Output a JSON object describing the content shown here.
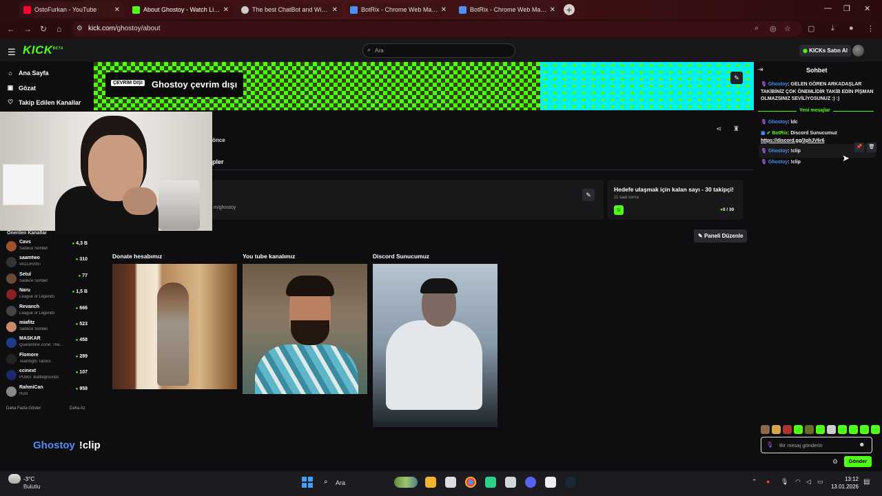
{
  "browser": {
    "tabs": [
      {
        "title": "OstoFurkan - YouTube",
        "favicon_color": "#ff0033"
      },
      {
        "title": "About Ghostoy - Watch Live on Kick",
        "favicon_color": "#53fc18"
      },
      {
        "title": "The best ChatBot and Widgets",
        "favicon_color": "#cccccc"
      },
      {
        "title": "BotRix - Chrome Web Mağazası",
        "favicon_color": "#4e8ef7"
      },
      {
        "title": "BotRix - Chrome Web Mağazası",
        "favicon_color": "#4e8ef7"
      }
    ],
    "url_host": "kick.com",
    "url_path": "/ghostoy/about"
  },
  "topnav": {
    "logo": "KICK",
    "logo_sup": "BETA",
    "search_placeholder": "Ara",
    "buy_kicks": "KICKs Satın Al"
  },
  "sidebar": {
    "nav": [
      {
        "label": "Ana Sayfa",
        "icon": "home-icon"
      },
      {
        "label": "Gözat",
        "icon": "browse-icon"
      },
      {
        "label": "Takip Edilen Kanallar",
        "icon": "heart-icon"
      }
    ],
    "suggested_title": "Önerilen Kanallar",
    "channels": [
      {
        "name": "Cavs",
        "category": "Sadece Sohbet",
        "viewers": "4,3 B",
        "color": "#a0522d"
      },
      {
        "name": "saamtwo",
        "category": "VALORANT",
        "viewers": "310",
        "color": "#333333"
      },
      {
        "name": "Setul",
        "category": "Sadece Sohbet",
        "viewers": "77",
        "color": "#6b4a33"
      },
      {
        "name": "Naru",
        "category": "League of Legends",
        "viewers": "1,5 B",
        "color": "#8a2020"
      },
      {
        "name": "Revanch",
        "category": "League of Legends",
        "viewers": "666",
        "color": "#444444"
      },
      {
        "name": "miafitz",
        "category": "Sadece Sohbet",
        "viewers": "523",
        "color": "#c88a6a"
      },
      {
        "name": "MASKAR",
        "category": "Quarantine Zone: The...",
        "viewers": "458",
        "color": "#1f3b8a"
      },
      {
        "name": "Flomore",
        "category": "Teamfight Tactics",
        "viewers": "289",
        "color": "#222222"
      },
      {
        "name": "ccinext",
        "category": "PUBG: Battlegrounds",
        "viewers": "107",
        "color": "#1b2a6b"
      },
      {
        "name": "RahmiCan",
        "category": "Rust",
        "viewers": "958",
        "color": "#888888"
      }
    ],
    "show_more": "Daha Fazla Göster",
    "show_less": "Daha Az"
  },
  "banner": {
    "offline_badge": "ÇEVRİM DIŞI",
    "offline_text": "Ghostoy çevrim dışı"
  },
  "channel": {
    "tab_partial_1": "önce",
    "tab_partial_2": "pler",
    "social_link": "m/ghostoy",
    "goal_title": "Hedefe ulaşmak için kalan sayı - 30 takipçi!",
    "goal_time": "11 saat sonra",
    "goal_current": "0",
    "goal_total": " / 30",
    "edit_panels": "Paneli Düzenle",
    "panels": [
      {
        "title": "Donate hesabımız"
      },
      {
        "title": "You tube kanalımız"
      },
      {
        "title": "Discord Sunucumuz"
      }
    ]
  },
  "caption": {
    "name": "Ghostoy",
    "text": "!clip"
  },
  "chat": {
    "title": "Sohbet",
    "messages": [
      {
        "nick": "Ghostoy",
        "text": ": GELEN GÖREN ARKADAŞLAR TAKİBİNİZ ÇOK ÖNEMLİDİR TAKİB EDİN PİŞMAN OLMAZSINIZ SEVİLİYOSUNUZ :) :)"
      },
      {
        "nick": "Ghostoy",
        "text": ": ldc"
      },
      {
        "nick": "BotRix",
        "text": ": Discord Sunucumuz ",
        "link": "https://discord.gg/3phJV6r6"
      },
      {
        "nick": "Ghostoy",
        "text": ": !clip"
      },
      {
        "nick": "Ghostoy",
        "text": ": !clip"
      }
    ],
    "new_messages_label": "Yeni mesajlar",
    "input_placeholder": "Bir mesaj gönderin",
    "send_label": "Gönder",
    "emote_colors": [
      "#8a6a4a",
      "#d4a54a",
      "#a33",
      "#53fc18",
      "#6a6a2a",
      "#53fc18",
      "#cccccc",
      "#53fc18",
      "#53fc18",
      "#53fc18",
      "#53fc18"
    ]
  },
  "taskbar": {
    "temp": "-3°C",
    "weather": "Bulutlu",
    "search": "Ara",
    "time": "13:12",
    "date": "13.01.2026"
  }
}
